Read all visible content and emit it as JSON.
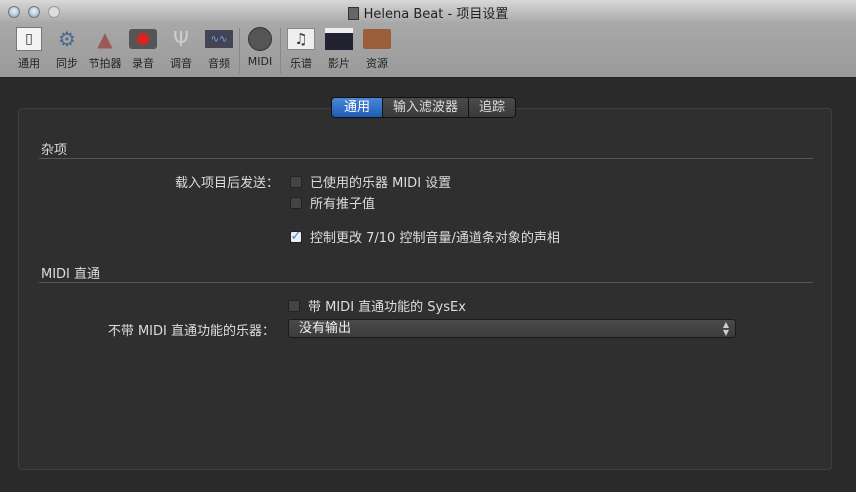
{
  "window": {
    "title": "Helena Beat - 项目设置"
  },
  "toolbar": [
    {
      "label": "通用",
      "icon": "switch-icon"
    },
    {
      "label": "同步",
      "icon": "gears-icon"
    },
    {
      "label": "节拍器",
      "icon": "metronome-icon"
    },
    {
      "label": "录音",
      "icon": "record-icon"
    },
    {
      "label": "调音",
      "icon": "tuning-fork-icon"
    },
    {
      "label": "音频",
      "icon": "waveform-icon"
    },
    {
      "label": "MIDI",
      "icon": "midi-port-icon"
    },
    {
      "label": "乐谱",
      "icon": "score-icon"
    },
    {
      "label": "影片",
      "icon": "clapper-icon"
    },
    {
      "label": "资源",
      "icon": "briefcase-icon"
    }
  ],
  "tabs": [
    {
      "label": "通用",
      "selected": true
    },
    {
      "label": "输入滤波器"
    },
    {
      "label": "追踪"
    }
  ],
  "misc": {
    "heading": "杂项",
    "send_label": "载入项目后发送：",
    "opt1": {
      "label": "已使用的乐器 MIDI 设置",
      "checked": false
    },
    "opt2": {
      "label": "所有推子值",
      "checked": false
    },
    "opt3": {
      "label": "控制更改 7/10 控制音量/通道条对象的声相",
      "checked": true
    }
  },
  "midi": {
    "heading": "MIDI 直通",
    "sysex": {
      "label": "带 MIDI 直通功能的 SysEx",
      "checked": false
    },
    "instr_label": "不带 MIDI 直通功能的乐器：",
    "instr_value": "没有输出"
  }
}
